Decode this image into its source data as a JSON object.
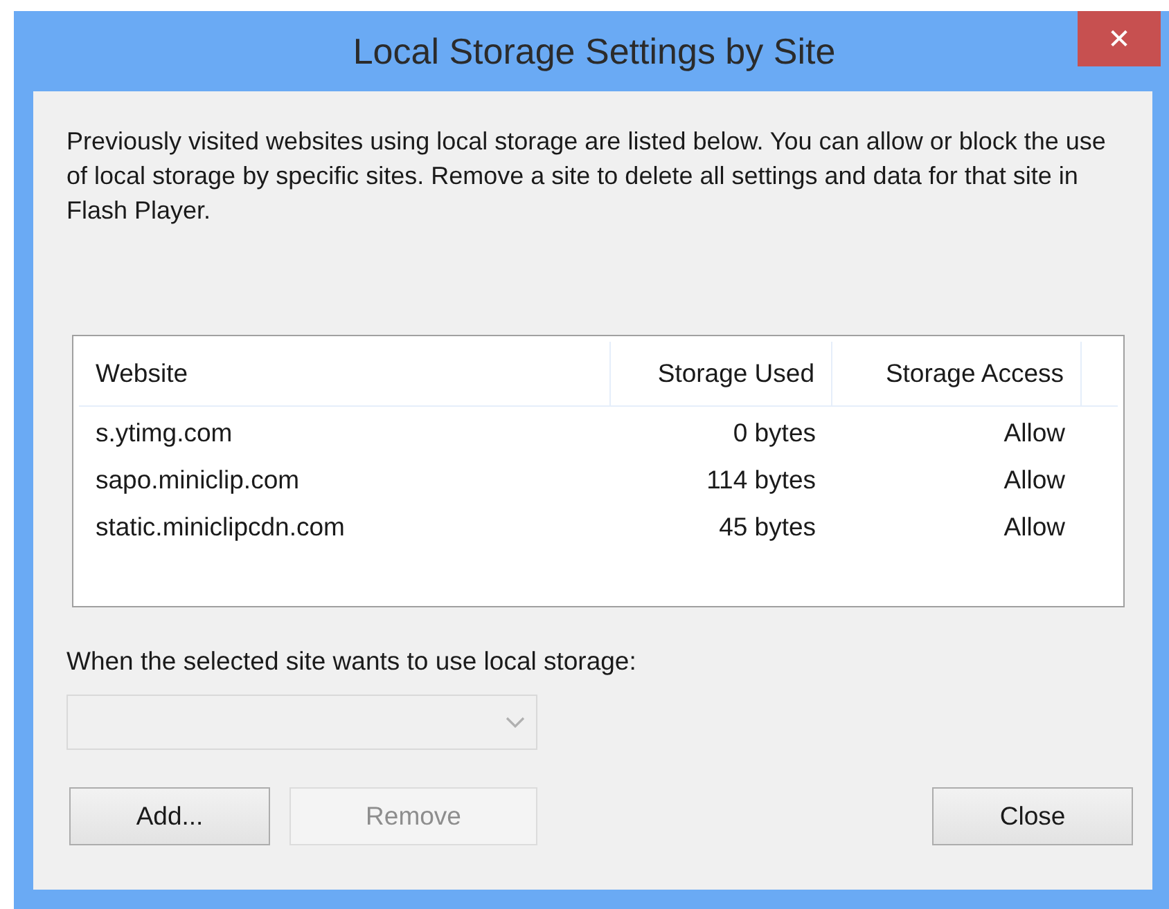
{
  "window": {
    "title": "Local Storage Settings by Site",
    "close_label": "✕"
  },
  "description": "Previously visited websites using local storage are listed below. You can allow or block the use of local storage by specific sites. Remove a site to delete all settings and data for that site in Flash Player.",
  "table": {
    "columns": [
      {
        "label": "Website"
      },
      {
        "label": "Storage Used"
      },
      {
        "label": "Storage Access"
      }
    ],
    "rows": [
      {
        "cells": [
          "s.ytimg.com",
          "0 bytes",
          "Allow"
        ],
        "selected": false
      },
      {
        "cells": [
          "sapo.miniclip.com",
          "114 bytes",
          "Allow"
        ],
        "selected": false
      },
      {
        "cells": [
          "static.miniclipcdn.com",
          "45 bytes",
          "Allow"
        ],
        "selected": false
      }
    ]
  },
  "access_label": "When the selected site wants to use local storage:",
  "access_dropdown": {
    "disabled": true
  },
  "buttons": [
    {
      "label": "Add...",
      "disabled": false
    },
    {
      "label": "Remove",
      "disabled": true
    },
    {
      "label": "Close",
      "disabled": false
    }
  ]
}
